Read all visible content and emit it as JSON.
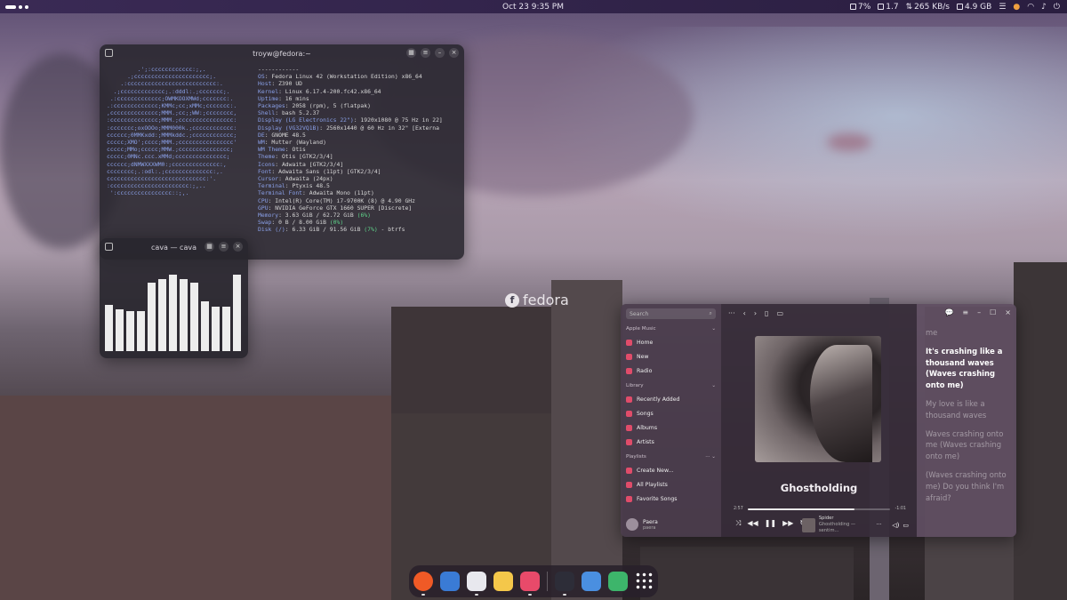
{
  "topbar": {
    "clock": "Oct 23  9:35 PM",
    "tray": {
      "cpu": "7%",
      "load": "1.7",
      "net": "265 KB/s",
      "mem": "4.9 GB"
    }
  },
  "wallpaper": {
    "logo_text": "fedora"
  },
  "terminal": {
    "title": "troyw@fedora:~",
    "separator": "------------",
    "ascii": "         .';:cccccccccccc:;,.\n      .;cccccccccccccccccccccc;.\n    .:cccccccccccccccccccccccccc:.\n  .;ccccccccccccc;.:dddl:.;ccccccc;.\n .:ccccccccccccc;OWMKOOXMWd;ccccccc:.\n.:ccccccccccccc;KMMc;cc;xMMc;ccccccc:.\n,cccccccccccccc;MMM.;cc;;WW:;cccccccc,\n:cccccccccccccc;MMM.;cccccccccccccccc:\n:ccccccc;oxOOOo;MMM000k.;cccccccccccc:\ncccccc;0MMKxdd:;MMMkddc.;cccccccccccc;\nccccc;XMO';cccc;MMM.;cccccccccccccccc'\nccccc;MMo;ccccc;MMW.;ccccccccccccccc;\nccccc;0MNc.ccc.xMMd;ccccccccccccccc;\ncccccc;dNMWXXXWM0:;cccccccccccccc:,\ncccccccc;.:odl:.;cccccccccccccc:,.\nccccccccccccccccccccccccccccc:'.\n:ccccccccccccccccccccccc:;,..\n ':cccccccccccccccc::;,.",
    "info": [
      {
        "k": "OS",
        "v": ": Fedora Linux 42 (Workstation Edition) x86_64"
      },
      {
        "k": "Host",
        "v": ": Z390 UD"
      },
      {
        "k": "Kernel",
        "v": ": Linux 6.17.4-200.fc42.x86_64"
      },
      {
        "k": "Uptime",
        "v": ": 16 mins"
      },
      {
        "k": "Packages",
        "v": ": 2058 (rpm), 5 (flatpak)"
      },
      {
        "k": "Shell",
        "v": ": bash 5.2.37"
      },
      {
        "k": "Display (LG Electronics 22\")",
        "v": ": 1920x1080 @ 75 Hz in 22]"
      },
      {
        "k": "Display (VG32VQ1B)",
        "v": ": 2560x1440 @ 60 Hz in 32\" [Externa"
      },
      {
        "k": "DE",
        "v": ": GNOME 48.5"
      },
      {
        "k": "WM",
        "v": ": Mutter (Wayland)"
      },
      {
        "k": "WM Theme",
        "v": ": Otis"
      },
      {
        "k": "Theme",
        "v": ": Otis [GTK2/3/4]"
      },
      {
        "k": "Icons",
        "v": ": Adwaita [GTK2/3/4]"
      },
      {
        "k": "Font",
        "v": ": Adwaita Sans (11pt) [GTK2/3/4]"
      },
      {
        "k": "Cursor",
        "v": ": Adwaita (24px)"
      },
      {
        "k": "Terminal",
        "v": ": Ptyxis 48.5"
      },
      {
        "k": "Terminal Font",
        "v": ": Adwaita Mono (11pt)"
      },
      {
        "k": "CPU",
        "v": ": Intel(R) Core(TM) i7-9700K (8) @ 4.90 GHz"
      },
      {
        "k": "GPU",
        "v": ": NVIDIA GeForce GTX 1660 SUPER [Discrete]"
      },
      {
        "k": "Memory",
        "v": ": 3.63 GiB / 62.72 GiB ",
        "g": "(6%)"
      },
      {
        "k": "Swap",
        "v": ": 0 B / 8.00 GiB ",
        "g": "(0%)"
      },
      {
        "k": "Disk (/)",
        "v": ": 6.33 GiB / 91.56 GiB ",
        "g": "(7%)",
        "tail": " - btrfs"
      }
    ]
  },
  "cava": {
    "title": "cava — cava",
    "bar_levels": [
      0.58,
      0.52,
      0.5,
      0.5,
      0.86,
      0.9,
      0.96,
      0.9,
      0.86,
      0.62,
      0.56,
      0.56,
      0.96
    ]
  },
  "music": {
    "search_placeholder": "Search",
    "sections": {
      "apple_music": "Apple Music",
      "library": "Library",
      "playlists": "Playlists"
    },
    "apple_items": [
      "Home",
      "New",
      "Radio"
    ],
    "library_items": [
      "Recently Added",
      "Songs",
      "Albums",
      "Artists"
    ],
    "playlist_items": [
      "Create New...",
      "All Playlists",
      "Favorite Songs"
    ],
    "user": {
      "name": "Paera",
      "sub": "paera"
    },
    "song_title": "Ghostholding",
    "elapsed": "2:57",
    "remaining": "-1:01",
    "progress": 0.75,
    "mini": {
      "title": "Spider",
      "sub": "Ghostholding — sentim..."
    },
    "lyrics": [
      {
        "text": "me",
        "active": false
      },
      {
        "text": "It's crashing like a thousand waves (Waves crashing onto me)",
        "active": true
      },
      {
        "text": "My love is like a thousand waves",
        "active": false
      },
      {
        "text": "Waves crashing onto me (Waves crashing onto me)",
        "active": false
      },
      {
        "text": "(Waves crashing onto me) Do you think I'm afraid?",
        "active": false
      }
    ]
  },
  "dock": {
    "apps": [
      {
        "name": "firefox",
        "color": "#f05a26",
        "running": true
      },
      {
        "name": "files",
        "color": "#3a7bd5",
        "running": false
      },
      {
        "name": "software",
        "color": "#e8e8ee",
        "running": true
      },
      {
        "name": "text-editor",
        "color": "#f4c74a",
        "running": false
      },
      {
        "name": "music",
        "color": "#e84a6a",
        "running": true
      },
      {
        "name": "terminal",
        "color": "#2d2d38",
        "running": true
      },
      {
        "name": "extensions",
        "color": "#4a8fe0",
        "running": false
      },
      {
        "name": "trash",
        "color": "#3db56b",
        "running": false
      },
      {
        "name": "app-grid",
        "color": "transparent",
        "running": false
      }
    ]
  }
}
